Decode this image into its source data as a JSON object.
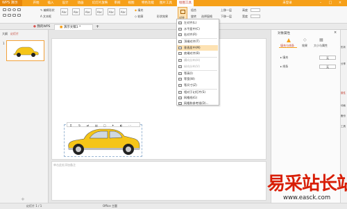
{
  "titlebar": {
    "app_name": "WPS 演示",
    "tabs": [
      "开始",
      "插入",
      "设计",
      "动画",
      "幻灯片放映",
      "审阅",
      "视图",
      "特色功能",
      "图片工具",
      "绘图工具"
    ],
    "login": "未登录"
  },
  "ribbon": {
    "edit_shape": "编辑形状",
    "text_box": "文本框",
    "style_label": "Abc",
    "fill": "填充",
    "outline": "轮廓",
    "shape_effect": "形状效果",
    "combine": "组合",
    "rotate": "旋转",
    "select_pane": "选择窗格",
    "bring_forward": "上移一层",
    "send_backward": "下移一层",
    "align": "对齐",
    "height_label": "高度",
    "width_label": "宽度",
    "height_value": "",
    "width_value": ""
  },
  "doctabs": {
    "tabs": [
      "我的WPS",
      "演示文稿1 *"
    ]
  },
  "left_panel": {
    "tab_outline": "大纲",
    "tab_slides": "幻灯片",
    "slide_number": "1"
  },
  "align_menu": {
    "items": [
      {
        "label": "左对齐(L)",
        "state": "normal"
      },
      {
        "label": "水平居中(C)",
        "state": "normal"
      },
      {
        "label": "右对齐(R)",
        "state": "normal"
      },
      {
        "label": "顶端对齐(T)",
        "state": "normal"
      },
      {
        "label": "垂直居中(M)",
        "state": "active"
      },
      {
        "label": "底端对齐(B)",
        "state": "normal"
      },
      {
        "label": "横向分布(H)",
        "state": "disabled"
      },
      {
        "label": "纵向分布(V)",
        "state": "disabled"
      },
      {
        "label": "等高(I)",
        "state": "normal"
      },
      {
        "label": "等宽(W)",
        "state": "normal"
      },
      {
        "label": "等尺寸(Z)",
        "state": "normal"
      },
      {
        "label": "相对于幻灯片(S)",
        "state": "normal"
      },
      {
        "label": "网格线(G)",
        "state": "normal"
      },
      {
        "label": "网格和参考线(D)...",
        "state": "normal"
      }
    ]
  },
  "right_panel": {
    "title": "对象属性",
    "tab_fill": "填充与线条",
    "tab_effect": "效果",
    "tab_size": "大小与属性",
    "section_fill": "填充",
    "section_line": "线条",
    "fill_value": "无",
    "line_value": "无",
    "strip_labels": [
      "形状",
      "分享",
      "属性",
      "动画",
      "备份",
      "工具"
    ]
  },
  "notes": {
    "placeholder": "单击此处添加备注"
  },
  "statusbar": {
    "slide_info": "幻灯片 1 / 1",
    "theme": "Office 主题"
  },
  "watermark": {
    "cn": "易采站长站",
    "url": "www.easck.com"
  },
  "colors": {
    "brand": "#f6a019",
    "watermark_red": "#d81e06",
    "car_yellow": "#f5c518"
  }
}
